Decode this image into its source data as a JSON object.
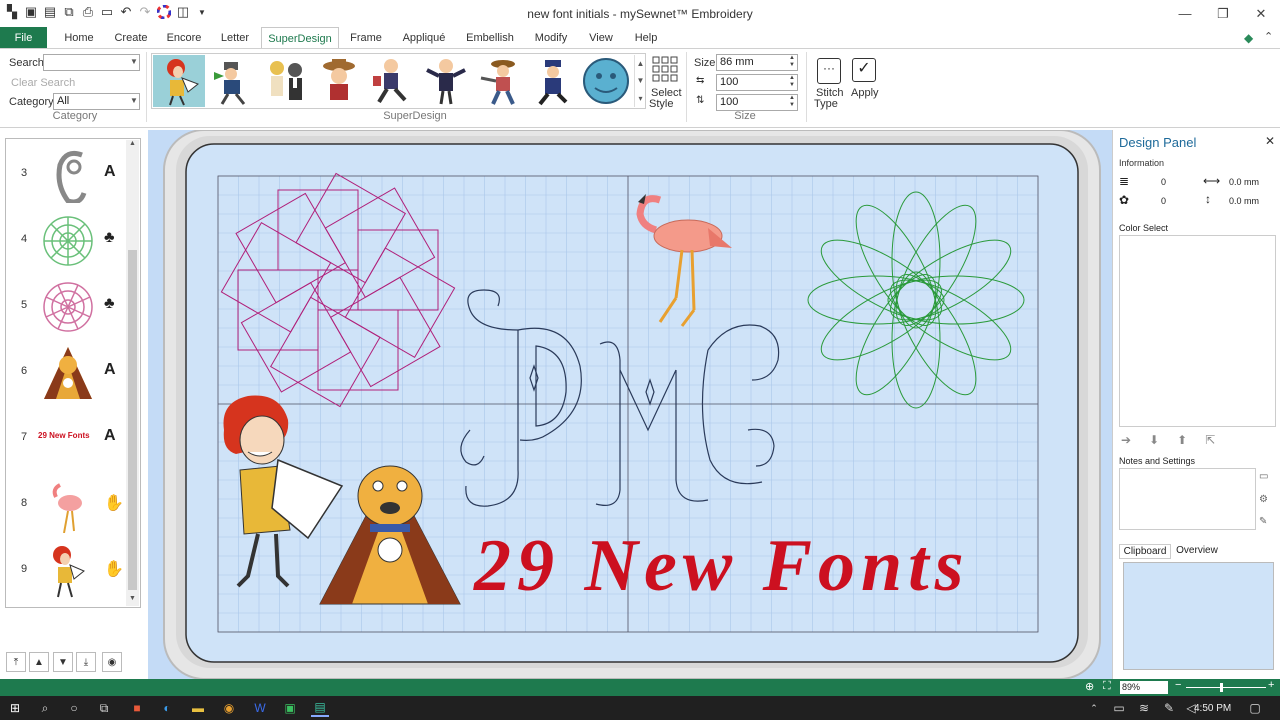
{
  "window": {
    "title": "new font initials -  mySewnet™ Embroidery",
    "controls": [
      "minimize",
      "restore",
      "close"
    ]
  },
  "quick_access": [
    "new-icon",
    "save-icon",
    "save-as-icon",
    "export-icon",
    "print-icon",
    "preview-icon",
    "undo-icon",
    "redo-icon",
    "color-wheel-icon",
    "hoop-icon",
    "customize-icon"
  ],
  "ribbon_tabs": {
    "file": "File",
    "tabs": [
      "Home",
      "Create",
      "Encore",
      "Letter",
      "SuperDesign",
      "Frame",
      "Appliqué",
      "Embellish",
      "Modify",
      "View",
      "Help"
    ],
    "active": "SuperDesign"
  },
  "category_group": {
    "search_label": "Search:",
    "search_value": "",
    "clear_label": "Clear Search",
    "category_label": "Category:",
    "category_value": "All",
    "caption": "Category"
  },
  "superdesign_group": {
    "caption": "SuperDesign",
    "thumbnails": [
      "woman-reading",
      "man-with-bugle",
      "couple",
      "cowboy",
      "walking-man",
      "man-waving",
      "cowboy-gun",
      "police-officer",
      "moon-face"
    ],
    "select_style_label": [
      "Select",
      "Style"
    ]
  },
  "size_group": {
    "caption": "Size",
    "size_label": "Size:",
    "size_value": "86 mm",
    "width_value": "100",
    "height_value": "100"
  },
  "apply_group": {
    "stitch_type_label": [
      "Stitch",
      "Type"
    ],
    "apply_label": "Apply"
  },
  "design_list": [
    {
      "num": "3",
      "type": "A",
      "design": "swirl-letter"
    },
    {
      "num": "4",
      "type": "tulip",
      "design": "green-flower"
    },
    {
      "num": "5",
      "type": "tulip",
      "design": "pink-flower"
    },
    {
      "num": "6",
      "type": "A",
      "design": "dog-letter-A"
    },
    {
      "num": "7",
      "type": "A",
      "design": "29 New Fonts"
    },
    {
      "num": "8",
      "type": "hand",
      "design": "flamingo"
    },
    {
      "num": "9",
      "type": "hand",
      "design": "woman-reading"
    }
  ],
  "canvas": {
    "headline": "29 New Fonts",
    "monogram": "DMC",
    "colors": {
      "red": "#cc1020",
      "magenta": "#b0207a",
      "green": "#2a9a3a",
      "navy": "#2a3a5a"
    }
  },
  "design_panel": {
    "title": "Design Panel",
    "information_label": "Information",
    "stitches": "0",
    "colors": "0",
    "width": "0.0 mm",
    "height": "0.0 mm",
    "color_select_label": "Color Select",
    "notes_label": "Notes and Settings",
    "tabs": [
      "Clipboard",
      "Overview"
    ]
  },
  "statusbar": {
    "zoom": "89%"
  },
  "taskbar": {
    "clock": "4:50 PM"
  }
}
